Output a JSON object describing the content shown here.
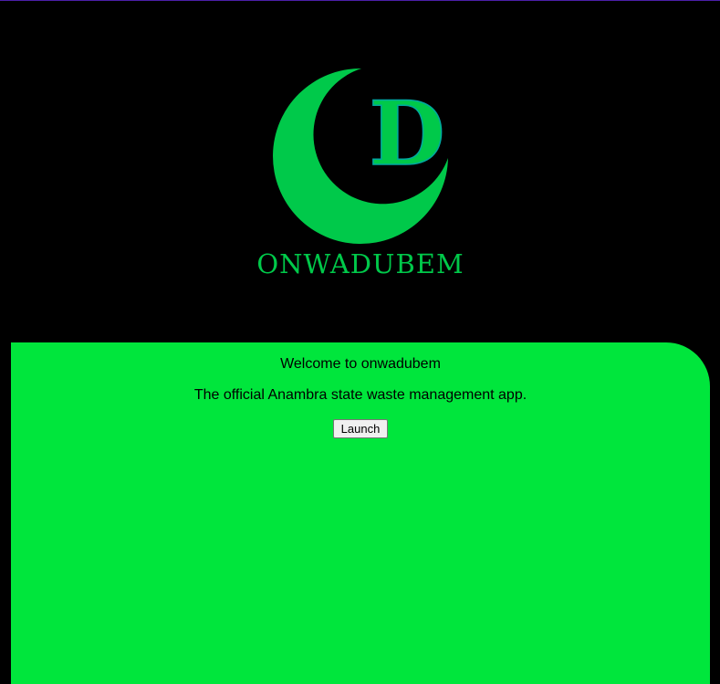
{
  "logo": {
    "letter": "D",
    "wordmark": "ONWADUBEM",
    "color": "#00c94a"
  },
  "panel": {
    "welcome_text": "Welcome to onwadubem",
    "tagline": "The official Anambra state waste management app.",
    "launch_label": "Launch",
    "background": "#00e63c"
  },
  "colors": {
    "page_background": "#000000",
    "top_border": "#4b1fa8"
  }
}
